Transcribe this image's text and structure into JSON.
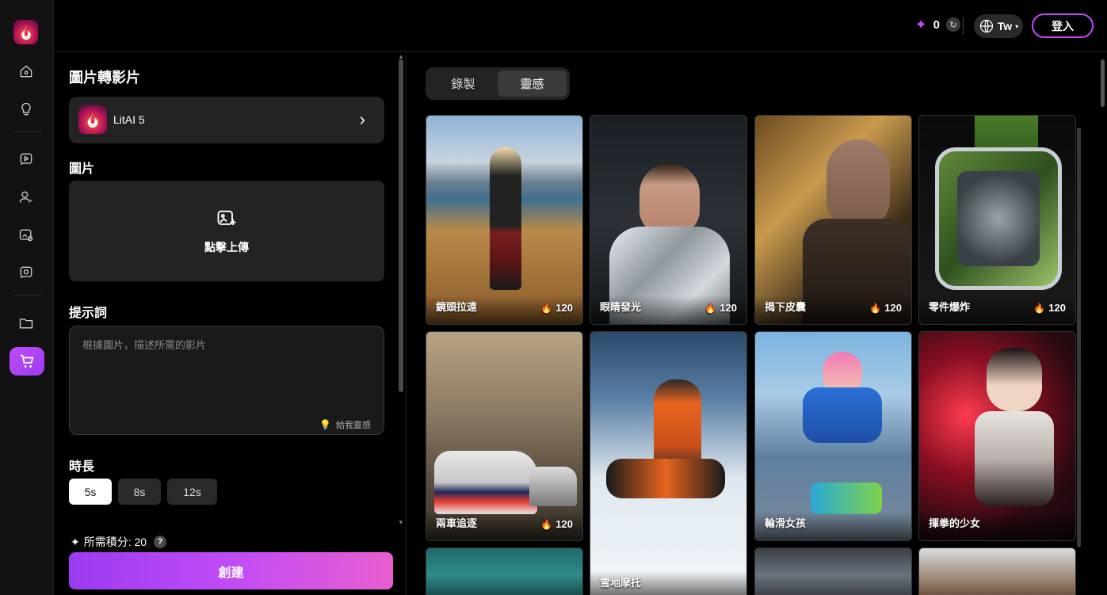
{
  "topbar": {
    "credits_value": "0",
    "language": "Tw",
    "login_label": "登入"
  },
  "panel": {
    "title": "圖片轉影片",
    "model_name": "LitAI 5",
    "image_label": "圖片",
    "upload_label": "點擊上傳",
    "prompt_label": "提示詞",
    "prompt_placeholder": "根據圖片，描述所需的影片",
    "inspire_label": "給我靈感",
    "duration_label": "時長",
    "durations": [
      "5s",
      "8s",
      "12s"
    ],
    "selected_duration": "5s",
    "cost_text": "所需積分: 20",
    "create_label": "創建"
  },
  "gallery": {
    "tabs": [
      "錄製",
      "靈感"
    ],
    "active_tab": "靈感",
    "cards": [
      {
        "title": "鏡頭拉遠",
        "score": "120"
      },
      {
        "title": "眼睛發光",
        "score": "120"
      },
      {
        "title": "揭下皮囊",
        "score": "120"
      },
      {
        "title": "零件爆炸",
        "score": "120"
      },
      {
        "title": "兩車追逐",
        "score": "120"
      },
      {
        "title": "雪地摩托",
        "score": ""
      },
      {
        "title": "輪滑女孩",
        "score": ""
      },
      {
        "title": "揮拳的少女",
        "score": ""
      }
    ]
  },
  "colors": {
    "accent": "#c04cf5",
    "background": "#000000",
    "surface": "#232323"
  }
}
